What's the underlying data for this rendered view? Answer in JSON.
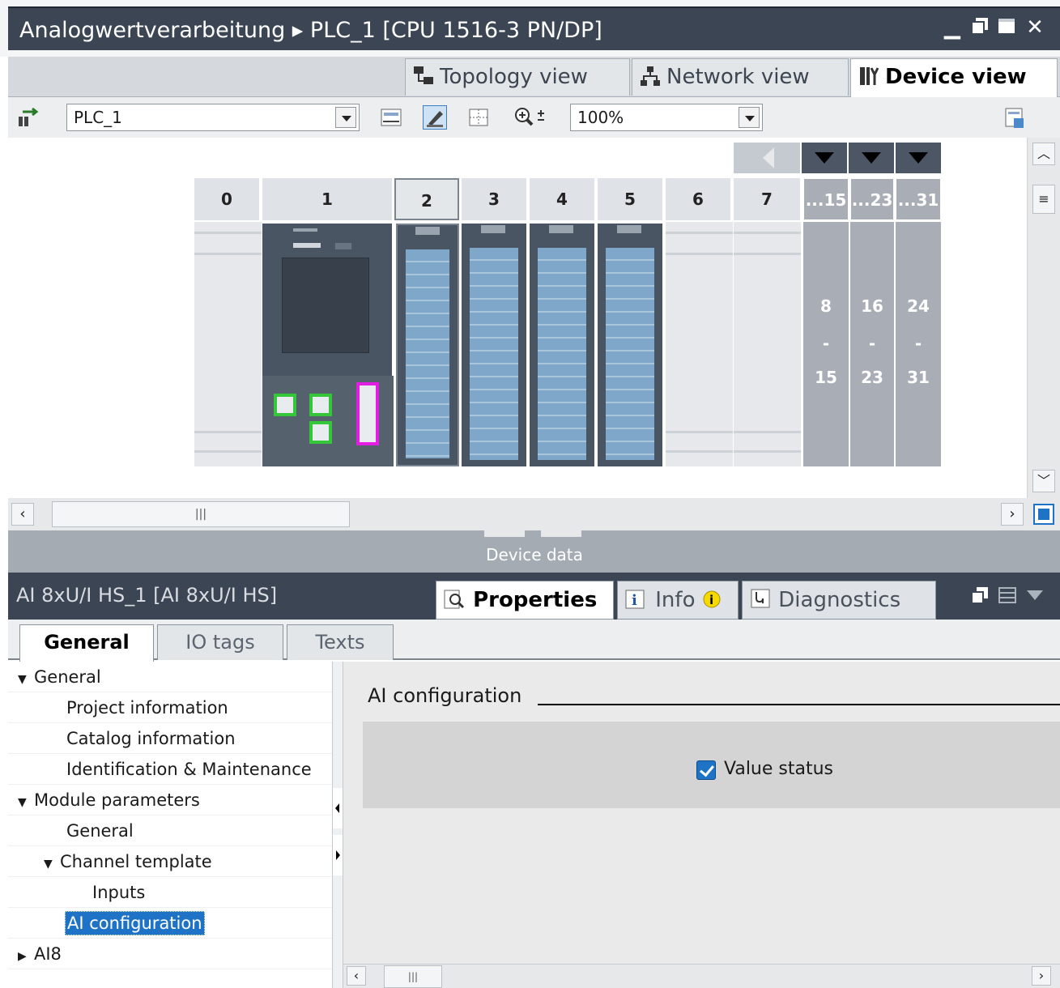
{
  "window": {
    "title": "Analogwertverarbeitung ▸ PLC_1 [CPU 1516-3 PN/DP]",
    "controls": [
      "minimize-icon",
      "restore-icon",
      "maximize-icon",
      "close-icon"
    ]
  },
  "view_tabs": [
    {
      "label": "Topology view",
      "icon": "topology-icon"
    },
    {
      "label": "Network view",
      "icon": "network-icon"
    },
    {
      "label": "Device view",
      "icon": "device-icon",
      "active": true
    }
  ],
  "toolbar": {
    "device_select": "PLC_1",
    "zoom": "100%",
    "zoom_icon": "zoom-icon"
  },
  "rack": {
    "slots": [
      "0",
      "1",
      "2",
      "3",
      "4",
      "5",
      "6",
      "7",
      "...15",
      "...23",
      "...31"
    ],
    "expansion": [
      {
        "from": "8",
        "sep": "-",
        "to": "15"
      },
      {
        "from": "16",
        "sep": "-",
        "to": "23"
      },
      {
        "from": "24",
        "sep": "-",
        "to": "31"
      }
    ],
    "selected_slot": "2"
  },
  "splitter": {
    "label": "Device data"
  },
  "properties": {
    "title": "AI 8xU/I HS_1 [AI 8xU/I HS]",
    "tabs": [
      {
        "label": "Properties",
        "icon": "properties-icon",
        "active": true
      },
      {
        "label": "Info",
        "icon": "info-icon"
      },
      {
        "label": "Diagnostics",
        "icon": "diagnostics-icon"
      }
    ]
  },
  "subtabs": [
    {
      "label": "General",
      "active": true
    },
    {
      "label": "IO tags"
    },
    {
      "label": "Texts"
    }
  ],
  "tree": [
    {
      "label": "General",
      "level": 0,
      "expander": "down"
    },
    {
      "label": "Project information",
      "level": 2
    },
    {
      "label": "Catalog information",
      "level": 2
    },
    {
      "label": "Identification & Maintenance",
      "level": 2
    },
    {
      "label": "Module parameters",
      "level": 0,
      "expander": "down"
    },
    {
      "label": "General",
      "level": 2
    },
    {
      "label": "Channel template",
      "level": 1,
      "expander": "down"
    },
    {
      "label": "Inputs",
      "level": 3
    },
    {
      "label": "AI configuration",
      "level": 2,
      "selected": true
    },
    {
      "label": "AI8",
      "level": 0,
      "expander": "right"
    }
  ],
  "content": {
    "section_title": "AI configuration",
    "checkbox_label": "Value status",
    "checkbox_checked": true
  },
  "colors": {
    "title_bar": "#3b4553",
    "accent": "#1f73c7",
    "selection": "#1f73c7",
    "module_body": "#4a5563",
    "port_green": "#35c63a",
    "port_magenta": "#e11ee1"
  }
}
